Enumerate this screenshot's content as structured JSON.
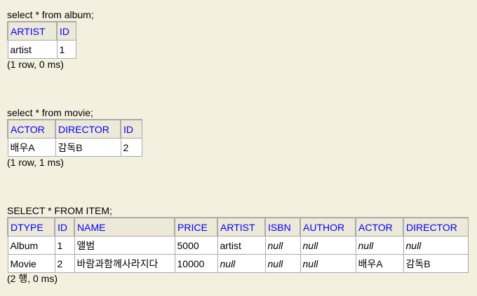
{
  "results": [
    {
      "query": "select * from album;",
      "columns": [
        "ARTIST",
        "ID"
      ],
      "rows": [
        [
          "artist",
          "1"
        ]
      ],
      "status": "(1 row, 0 ms)"
    },
    {
      "query": "select * from movie;",
      "columns": [
        "ACTOR",
        "DIRECTOR",
        "ID"
      ],
      "rows": [
        [
          "배우A",
          "감독B",
          "2"
        ]
      ],
      "status": "(1 row, 1 ms)"
    },
    {
      "query": "SELECT * FROM ITEM;",
      "columns": [
        "DTYPE",
        "ID",
        "NAME",
        "PRICE",
        "ARTIST",
        "ISBN",
        "AUTHOR",
        "ACTOR",
        "DIRECTOR"
      ],
      "rows": [
        [
          "Album",
          "1",
          "앨범",
          "5000",
          "artist",
          "null",
          "null",
          "null",
          "null"
        ],
        [
          "Movie",
          "2",
          "바람과함께사라지다",
          "10000",
          "null",
          "null",
          "null",
          "배우A",
          "감독B"
        ]
      ],
      "status": "(2 행, 0 ms)"
    }
  ]
}
